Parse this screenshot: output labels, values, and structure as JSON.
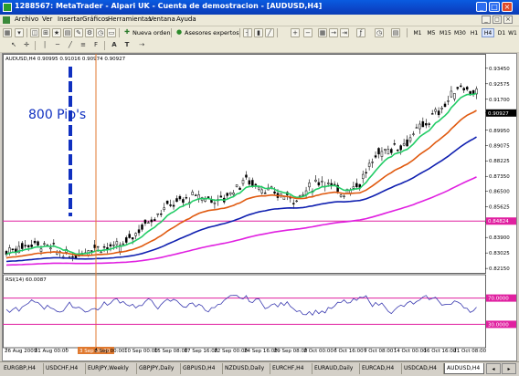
{
  "window": {
    "title": "1288567: MetaTrader - Alpari UK - Cuenta de demostracion - [AUDUSD,H4]"
  },
  "menu": [
    "Archivo",
    "Ver",
    "Insertar",
    "Gráficos",
    "Herramientas",
    "Ventana",
    "Ayuda"
  ],
  "toolbar": {
    "new_order_label": "Nueva orden",
    "experts_label": "Asesores expertos",
    "timeframes": [
      "M1",
      "M5",
      "M15",
      "M30",
      "H1",
      "H4",
      "D1",
      "W1",
      "MN"
    ],
    "active_timeframe": "H4"
  },
  "chart": {
    "header": "AUDUSD,H4  0.90995 0.91016 0.90974 0.90927",
    "annotation": "800 Pip's",
    "rsi_header": "RSI(14) 60.0087",
    "price_ticks": [
      "0.93450",
      "0.92575",
      "0.91700",
      "0.90927",
      "0.89950",
      "0.89075",
      "0.88225",
      "0.87350",
      "0.86500",
      "0.85625",
      "0.84750",
      "0.83900",
      "0.83025",
      "0.82150"
    ],
    "current_price": "0.90927",
    "level_price": "0.84824",
    "rsi_ticks": [
      "70.0000",
      "30.0000"
    ],
    "date_ticks": [
      "26 Aug 2009",
      "31 Aug 00:00",
      "3 Sep 08:00",
      "8 Sep 00:00",
      "10 Sep 00:00",
      "15 Sep 08:00",
      "17 Sep 16:00",
      "22 Sep 00:00",
      "24 Sep 16:00",
      "29 Sep 08:00",
      "2 Oct 00:00",
      "6 Oct 16:00",
      "9 Oct 08:00",
      "14 Oct 00:00",
      "16 Oct 16:00",
      "21 Oct 08:00"
    ],
    "highlight_date": "3 Sep 08:00",
    "colors": {
      "candles": "#000000",
      "ema_fast": "#22cc66",
      "ema_mid": "#e05a10",
      "ema_slow": "#1020b0",
      "ema_long": "#e020e0",
      "level_line": "#e020a0",
      "vertical_line": "#e07a30",
      "rsi_line": "#3a3ab0",
      "rsi_levels": "#e020a0",
      "annotation": "#1030c0"
    }
  },
  "tabs": [
    "EURGBP,H4",
    "USDCHF,H4",
    "EURJPY,Weekly",
    "GBPJPY,Daily",
    "GBPUSD,H4",
    "NZDUSD,Daily",
    "EURCHF,H4",
    "EURAUD,Daily",
    "EURCAD,H4",
    "USDCAD,H4",
    "AUDUSD,H4"
  ],
  "active_tab": "AUDUSD,H4"
}
